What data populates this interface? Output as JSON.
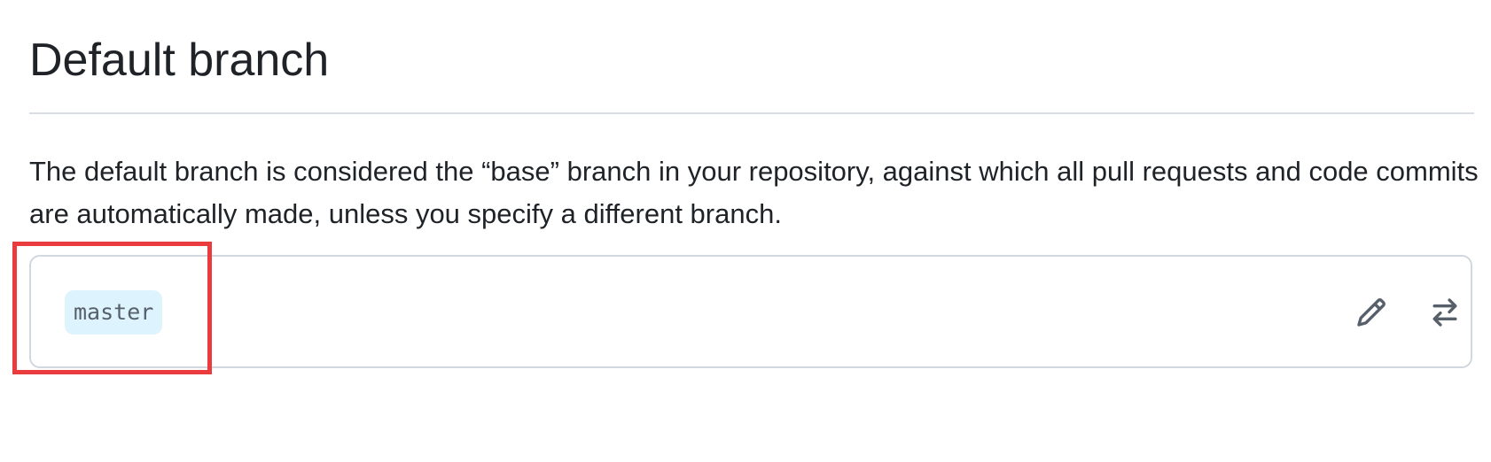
{
  "section": {
    "title": "Default branch",
    "description": "The default branch is considered the “base” branch in your repository, against which all pull requests and code commits are automatically made, unless you specify a different branch."
  },
  "branch": {
    "name": "master",
    "actions": [
      {
        "icon": "pencil-icon",
        "label": "Rename branch"
      },
      {
        "icon": "arrow-switch-icon",
        "label": "Switch to another branch"
      }
    ]
  },
  "colors": {
    "text": "#1f2328",
    "divider": "#d8dee4",
    "box_border": "#d0d7de",
    "pill_background": "#ddf4ff",
    "pill_text": "#57606a",
    "icon": "#57606a",
    "highlight": "#ea3b3f"
  }
}
